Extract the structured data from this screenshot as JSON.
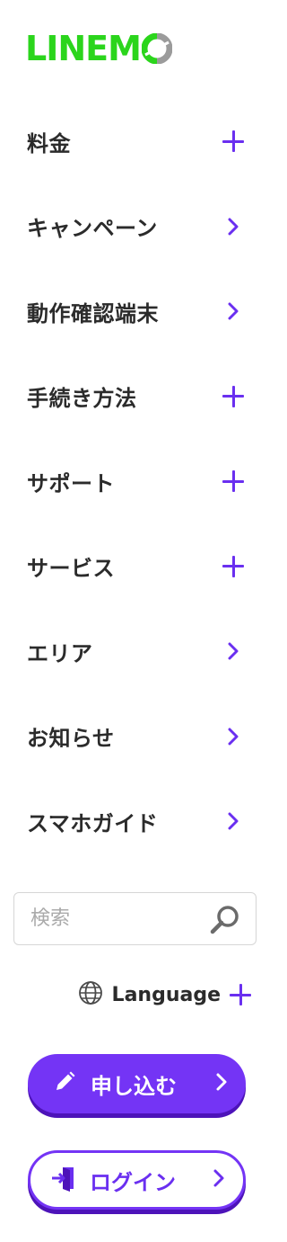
{
  "logo": {
    "text": "LINEM",
    "brand_green": "#2bd51c",
    "accent_gray": "#9b9b9b"
  },
  "menu": {
    "items": [
      {
        "label": "料金",
        "indicator": "plus-icon"
      },
      {
        "label": "キャンペーン",
        "indicator": "chevron-right-icon"
      },
      {
        "label": "動作確認端末",
        "indicator": "chevron-right-icon"
      },
      {
        "label": "手続き方法",
        "indicator": "plus-icon"
      },
      {
        "label": "サポート",
        "indicator": "plus-icon"
      },
      {
        "label": "サービス",
        "indicator": "plus-icon"
      },
      {
        "label": "エリア",
        "indicator": "chevron-right-icon"
      },
      {
        "label": "お知らせ",
        "indicator": "chevron-right-icon"
      },
      {
        "label": "スマホガイド",
        "indicator": "chevron-right-icon"
      }
    ]
  },
  "search": {
    "placeholder": "検索",
    "value": "",
    "icon": "search-icon"
  },
  "language": {
    "label": "Language",
    "icon": "globe-icon"
  },
  "buttons": {
    "apply_label": "申し込む",
    "apply_icon": "pencil-icon",
    "login_label": "ログイン",
    "login_icon": "login-door-icon"
  },
  "colors": {
    "accent": "#7434f5",
    "accent_dark": "#4d13b9",
    "text": "#2b2b2b"
  }
}
